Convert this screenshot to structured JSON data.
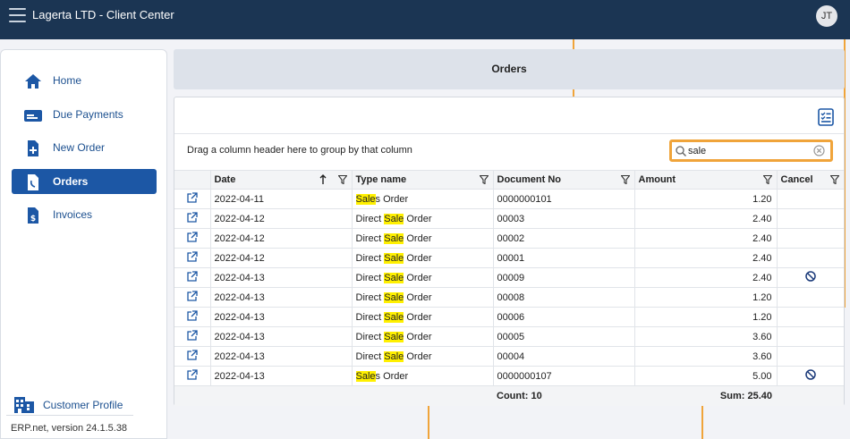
{
  "app": {
    "title": "Lagerta LTD - Client Center",
    "user_initials": "JT"
  },
  "sidebar": {
    "items": [
      {
        "label": "Home",
        "icon": "home-icon"
      },
      {
        "label": "Due Payments",
        "icon": "card-icon"
      },
      {
        "label": "New Order",
        "icon": "new-document-icon"
      },
      {
        "label": "Orders",
        "icon": "document-icon",
        "active": true
      },
      {
        "label": "Invoices",
        "icon": "invoice-icon"
      }
    ],
    "profile_label": "Customer Profile",
    "version": "ERP.net, version 24.1.5.38"
  },
  "page": {
    "title": "Orders"
  },
  "grid": {
    "group_hint": "Drag a column header here to group by that column",
    "search_value": "sale",
    "columns": [
      "Date",
      "Type name",
      "Document No",
      "Amount",
      "Cancel"
    ],
    "rows": [
      {
        "date": "2022-04-11",
        "type_pre": "",
        "type_hl": "Sale",
        "type_post": "s Order",
        "doc": "0000000101",
        "amount": "1.20",
        "cancel": false
      },
      {
        "date": "2022-04-12",
        "type_pre": "Direct ",
        "type_hl": "Sale",
        "type_post": " Order",
        "doc": "00003",
        "amount": "2.40",
        "cancel": false
      },
      {
        "date": "2022-04-12",
        "type_pre": "Direct ",
        "type_hl": "Sale",
        "type_post": " Order",
        "doc": "00002",
        "amount": "2.40",
        "cancel": false
      },
      {
        "date": "2022-04-12",
        "type_pre": "Direct ",
        "type_hl": "Sale",
        "type_post": " Order",
        "doc": "00001",
        "amount": "2.40",
        "cancel": false
      },
      {
        "date": "2022-04-13",
        "type_pre": "Direct ",
        "type_hl": "Sale",
        "type_post": " Order",
        "doc": "00009",
        "amount": "2.40",
        "cancel": true
      },
      {
        "date": "2022-04-13",
        "type_pre": "Direct ",
        "type_hl": "Sale",
        "type_post": " Order",
        "doc": "00008",
        "amount": "1.20",
        "cancel": false
      },
      {
        "date": "2022-04-13",
        "type_pre": "Direct ",
        "type_hl": "Sale",
        "type_post": " Order",
        "doc": "00006",
        "amount": "1.20",
        "cancel": false
      },
      {
        "date": "2022-04-13",
        "type_pre": "Direct ",
        "type_hl": "Sale",
        "type_post": " Order",
        "doc": "00005",
        "amount": "3.60",
        "cancel": false
      },
      {
        "date": "2022-04-13",
        "type_pre": "Direct ",
        "type_hl": "Sale",
        "type_post": " Order",
        "doc": "00004",
        "amount": "3.60",
        "cancel": false
      },
      {
        "date": "2022-04-13",
        "type_pre": "",
        "type_hl": "Sale",
        "type_post": "s Order",
        "doc": "0000000107",
        "amount": "5.00",
        "cancel": true
      }
    ],
    "footer": {
      "count": "Count: 10",
      "sum": "Sum: 25.40"
    }
  },
  "colors": {
    "topbar": "#1b3553",
    "accent": "#1c57a5",
    "search_border": "#f0a43a",
    "highlight": "#fff000"
  }
}
